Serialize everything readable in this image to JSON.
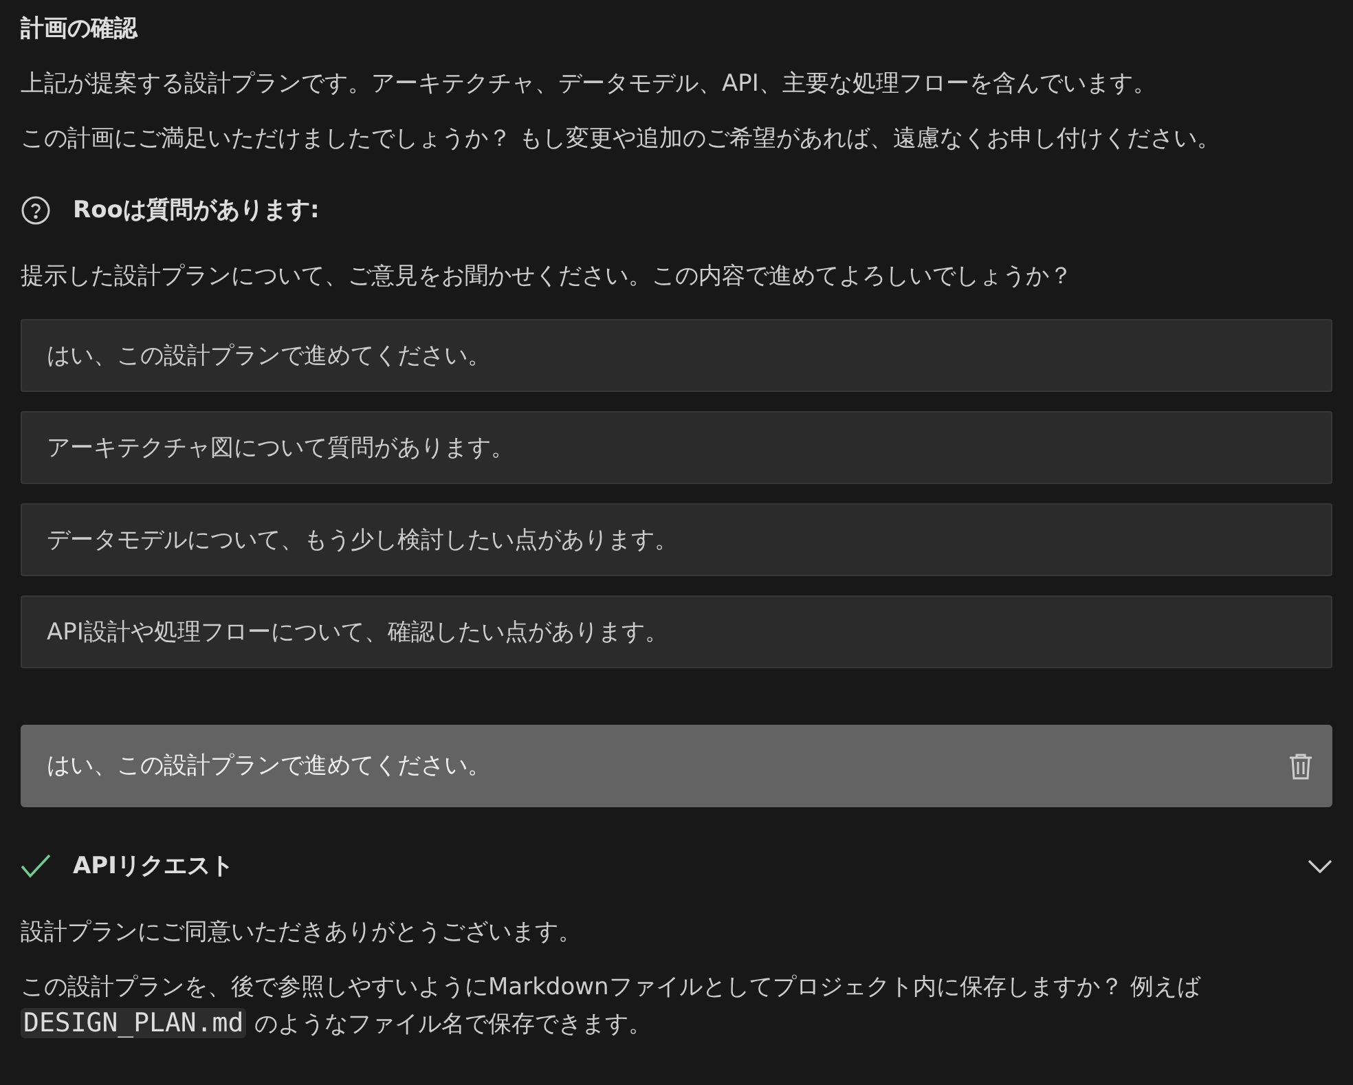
{
  "plan": {
    "title": "計画の確認",
    "paragraphs": [
      "上記が提案する設計プランです。アーキテクチャ、データモデル、API、主要な処理フローを含んでいます。",
      "この計画にご満足いただけましたでしょうか？ もし変更や追加のご希望があれば、遠慮なくお申し付けください。"
    ]
  },
  "question": {
    "title": "Rooは質問があります:",
    "text": "提示した設計プランについて、ご意見をお聞かせください。この内容で進めてよろしいでしょうか？",
    "options": [
      "はい、この設計プランで進めてください。",
      "アーキテクチャ図について質問があります。",
      "データモデルについて、もう少し検討したい点があります。",
      "API設計や処理フローについて、確認したい点があります。"
    ]
  },
  "user_message": {
    "text": "はい、この設計プランで進めてください。"
  },
  "api_request": {
    "title": "APIリクエスト",
    "done": true,
    "expanded": false
  },
  "reply": {
    "paragraph": "設計プランにご同意いただきありがとうございます。",
    "text_before": "この設計プランを、後で参照しやすいようにMarkdownファイルとしてプロジェクト内に保存しますか？ 例えば",
    "code": "DESIGN_PLAN.md",
    "text_after": "のようなファイル名で保存できます。"
  }
}
